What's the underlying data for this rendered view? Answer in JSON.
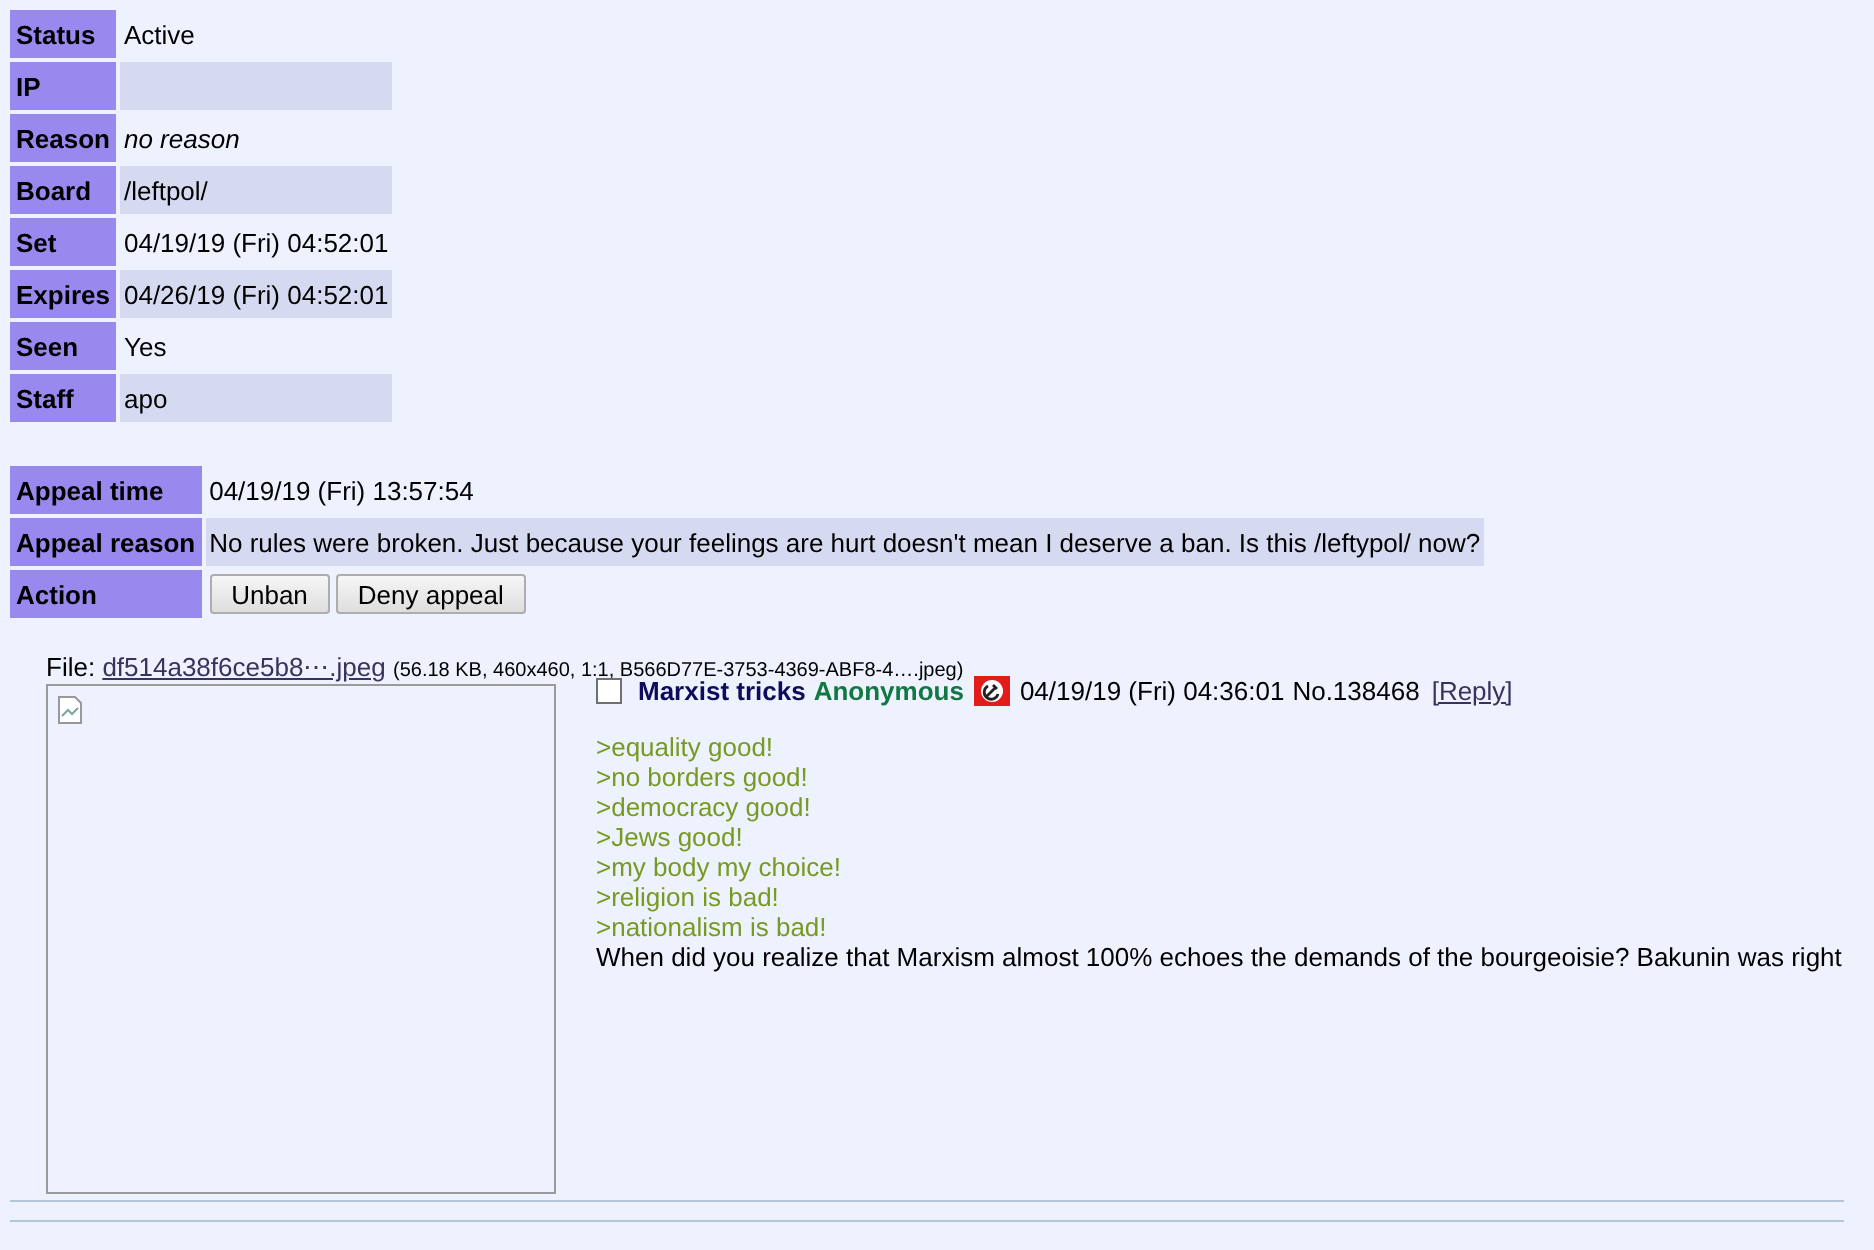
{
  "ban": [
    {
      "label": "Status",
      "value": "Active"
    },
    {
      "label": "IP"
    },
    {
      "label": "Reason",
      "value": "no reason",
      "italic": true
    },
    {
      "label": "Board",
      "value": "/leftpol/"
    },
    {
      "label": "Set",
      "value": "04/19/19 (Fri) 04:52:01"
    },
    {
      "label": "Expires",
      "value": "04/26/19 (Fri) 04:52:01"
    },
    {
      "label": "Seen",
      "value": "Yes"
    },
    {
      "label": "Staff",
      "value": "apo"
    }
  ],
  "appeal": [
    {
      "kind": "text",
      "label": "Appeal time",
      "value": "04/19/19 (Fri) 13:57:54"
    },
    {
      "kind": "text",
      "label": "Appeal reason",
      "value": "No rules were broken. Just because your feelings are hurt doesn't mean I deserve a ban. Is this /leftypol/ now?"
    },
    {
      "kind": "buttons",
      "label": "Action",
      "buttons": [
        "Unban",
        "Deny appeal"
      ]
    }
  ],
  "post": {
    "file_label": "File:",
    "file_name": "df514a38f6ce5b8⋯.jpeg",
    "file_info": "(56.18 KB, 460x460, 1:1, B566D77E-3753-4369-ABF8-4….jpeg)",
    "checked": false,
    "subject": "Marxist tricks",
    "name": "Anonymous",
    "date": "04/19/19 (Fri) 04:36:01",
    "number": "No.138468",
    "reply": "[Reply]",
    "lines": [
      {
        "kind": "quote",
        "text": ">equality good!"
      },
      {
        "kind": "quote",
        "text": ">no borders good!"
      },
      {
        "kind": "quote",
        "text": ">democracy good!"
      },
      {
        "kind": "quote",
        "text": ">Jews good!"
      },
      {
        "kind": "quote",
        "text": ">my body my choice!"
      },
      {
        "kind": "quote",
        "text": ">religion is bad!"
      },
      {
        "kind": "quote",
        "text": ">nationalism is bad!"
      },
      {
        "kind": "text",
        "text": "When did you realize that Marxism almost 100% echoes the demands of the bourgeoisie? Bakunin was right"
      }
    ]
  }
}
